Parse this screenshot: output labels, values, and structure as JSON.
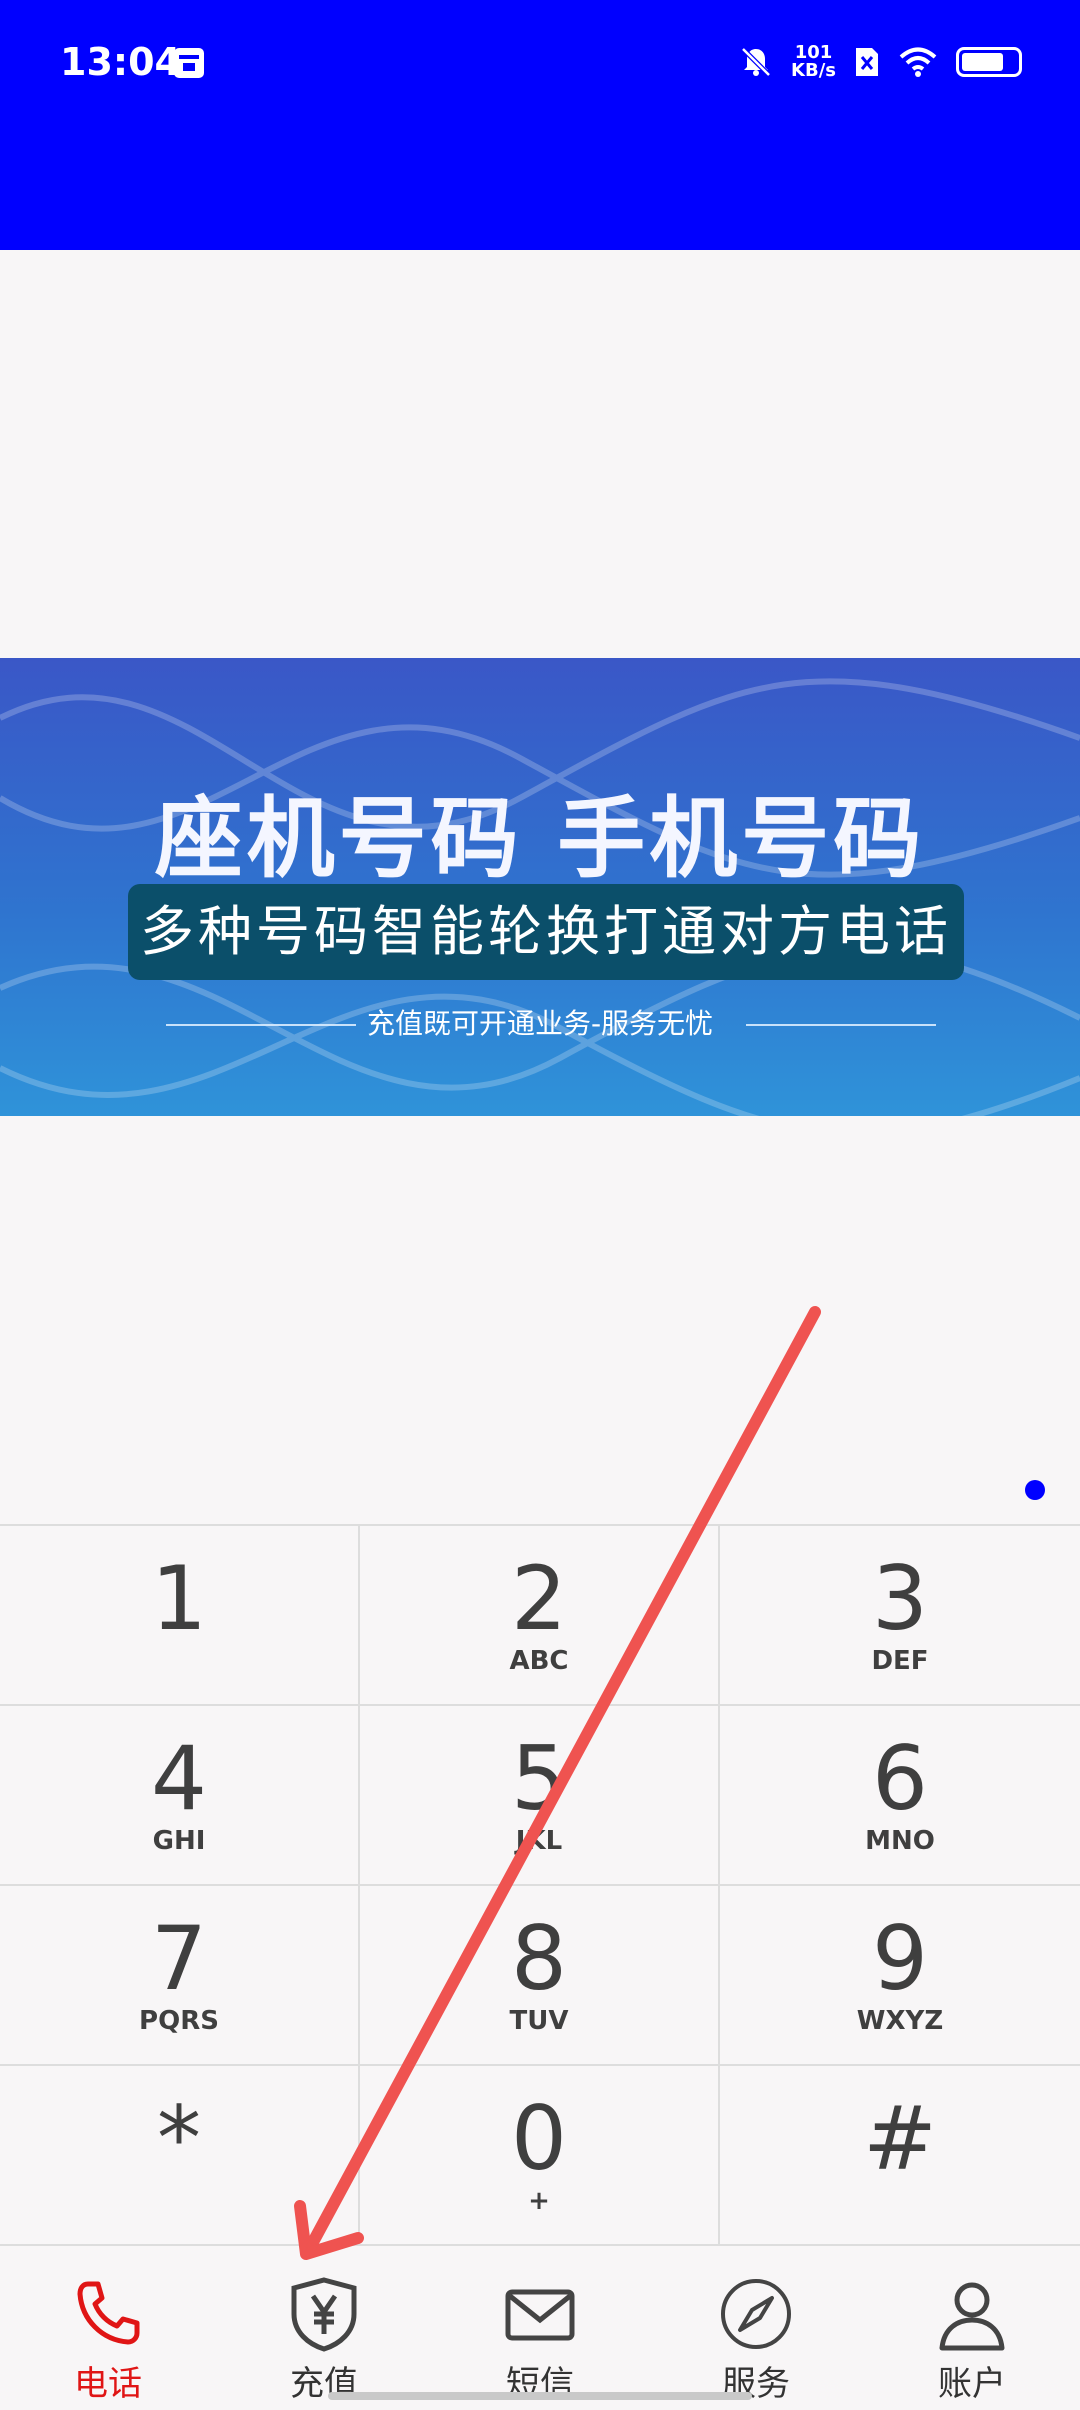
{
  "status_bar": {
    "time": "13:04",
    "net_speed_value": "101",
    "net_speed_unit": "KB/s",
    "battery_level": 0.75,
    "background_color": "#0000ff"
  },
  "banner": {
    "title": "座机号码 手机号码",
    "subtitle": "多种号码智能轮换打通对方电话",
    "tagline": "充值既可开通业务-服务无忧"
  },
  "dialpad": {
    "keys": [
      {
        "digit": "1",
        "letters": ""
      },
      {
        "digit": "2",
        "letters": "ABC"
      },
      {
        "digit": "3",
        "letters": "DEF"
      },
      {
        "digit": "4",
        "letters": "GHI"
      },
      {
        "digit": "5",
        "letters": "JKL"
      },
      {
        "digit": "6",
        "letters": "MNO"
      },
      {
        "digit": "7",
        "letters": "PQRS"
      },
      {
        "digit": "8",
        "letters": "TUV"
      },
      {
        "digit": "9",
        "letters": "WXYZ"
      },
      {
        "digit": "*",
        "letters": ""
      },
      {
        "digit": "0",
        "letters": "+"
      },
      {
        "digit": "#",
        "letters": ""
      }
    ]
  },
  "tabbar": {
    "items": [
      {
        "label": "电话",
        "icon": "phone-icon",
        "active": true
      },
      {
        "label": "充值",
        "icon": "yuan-shield-icon",
        "active": false
      },
      {
        "label": "短信",
        "icon": "envelope-icon",
        "active": false
      },
      {
        "label": "服务",
        "icon": "compass-icon",
        "active": false
      },
      {
        "label": "账户",
        "icon": "user-icon",
        "active": false
      }
    ],
    "active_color": "#e01515"
  },
  "annotation": {
    "color": "#ef5350"
  }
}
